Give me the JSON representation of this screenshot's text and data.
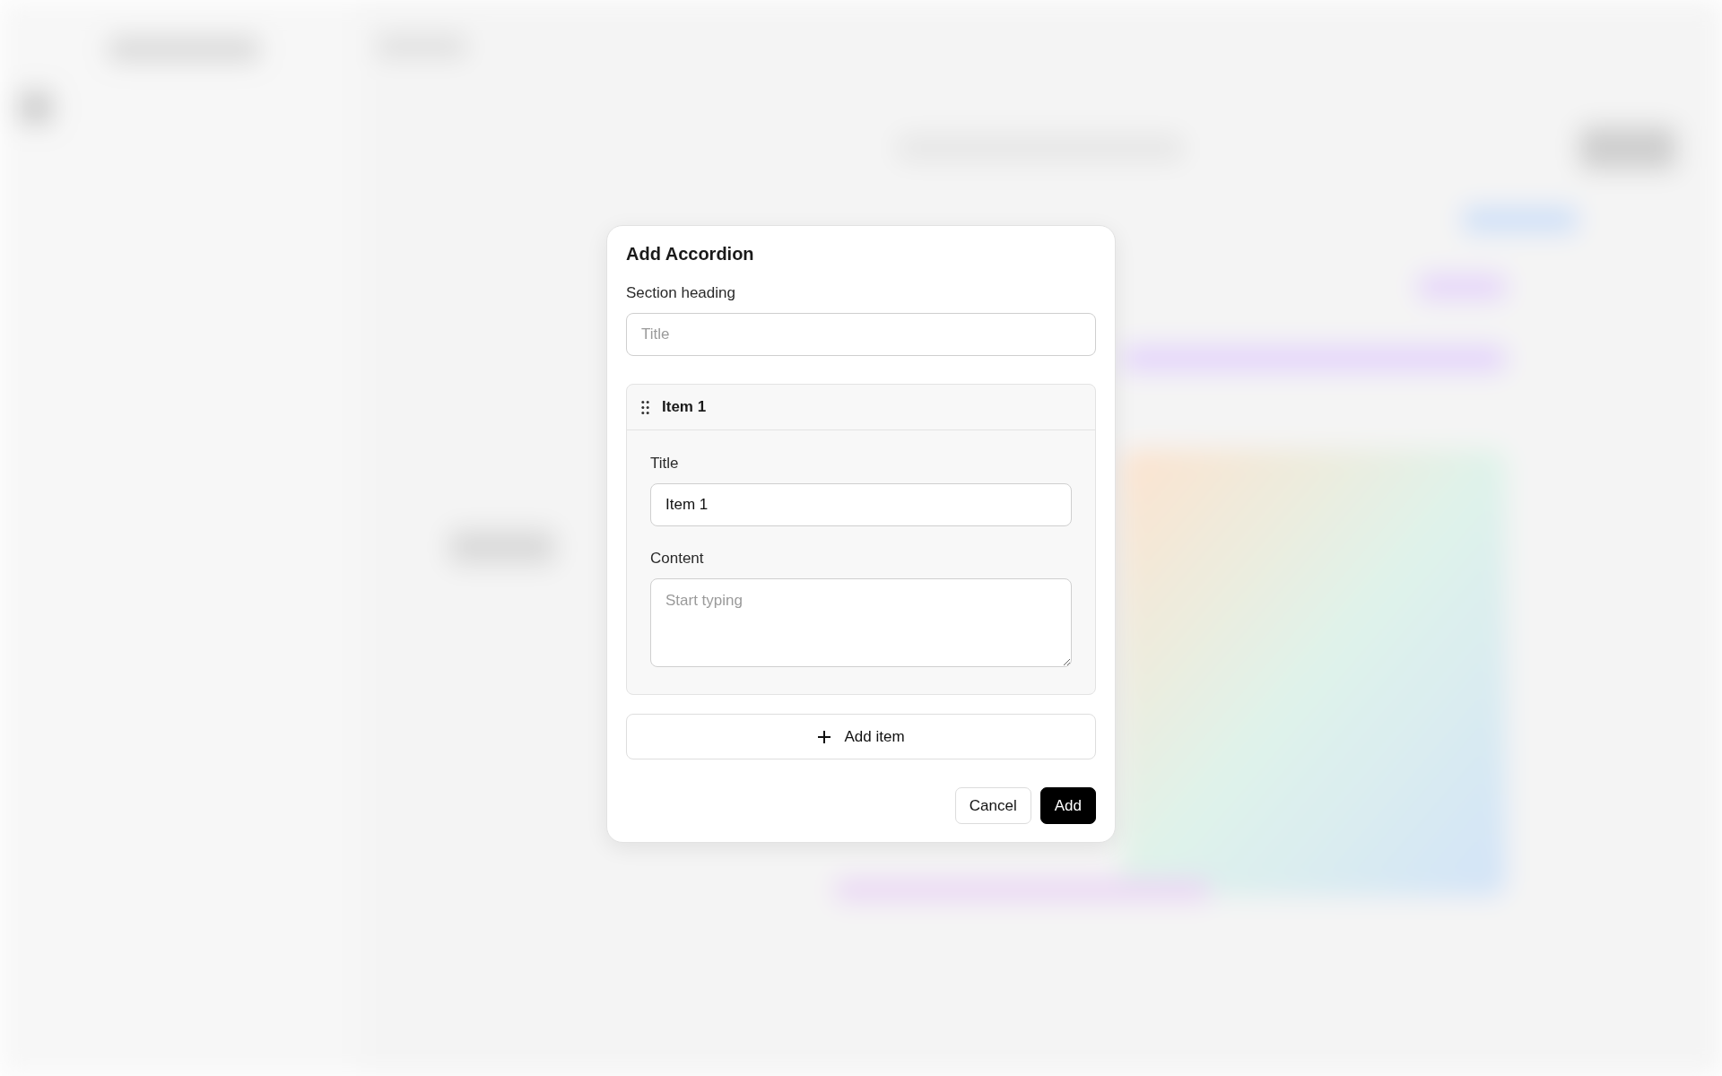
{
  "dialog": {
    "title": "Add Accordion",
    "section_heading": {
      "label": "Section heading",
      "placeholder": "Title"
    },
    "items": [
      {
        "name": "Item 1",
        "expanded": true,
        "title_label": "Title",
        "title_value": "Item 1",
        "content_label": "Content",
        "content_placeholder": "Start typing"
      }
    ],
    "add_item": "Add item",
    "buttons": [
      {
        "label": "Cancel",
        "kind": "secondary"
      },
      {
        "label": "Add",
        "kind": "primary"
      }
    ]
  }
}
